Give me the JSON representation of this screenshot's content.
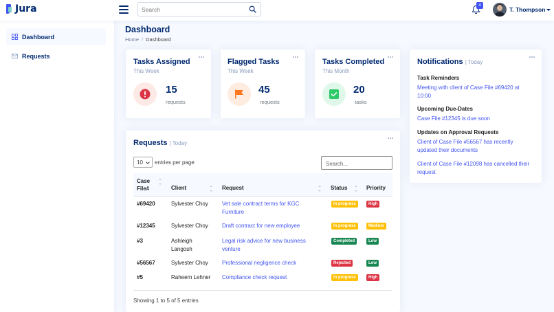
{
  "app": {
    "name": "Jura"
  },
  "header": {
    "search_placeholder": "Search",
    "notification_count": "4",
    "user_name": "T. Thompson"
  },
  "sidebar": {
    "items": [
      {
        "label": "Dashboard",
        "icon": "grid-icon",
        "active": true
      },
      {
        "label": "Requests",
        "icon": "envelope-icon",
        "active": false
      }
    ]
  },
  "page": {
    "title": "Dashboard",
    "breadcrumb": {
      "home": "Home",
      "separator": "/",
      "current": "Dashboard"
    }
  },
  "stats": [
    {
      "title": "Tasks Assigned",
      "period": "This Week",
      "value": "15",
      "unit": "requests",
      "icon": "exclamation-icon",
      "accent": "#dc3545",
      "tint": "#fde9e6"
    },
    {
      "title": "Flagged Tasks",
      "period": "This Week",
      "value": "45",
      "unit": "requests",
      "icon": "flag-icon",
      "accent": "#ff771d",
      "tint": "#ffece0"
    },
    {
      "title": "Tasks Completed",
      "period": "This Month",
      "value": "20",
      "unit": "tasks",
      "icon": "check-square-icon",
      "accent": "#2eca6a",
      "tint": "#e0f8e9"
    }
  ],
  "requests": {
    "title": "Requests",
    "period": "| Today",
    "entries_value": "10",
    "entries_label": "entries per page",
    "search_placeholder": "Search...",
    "columns": [
      "Case File#",
      "Client",
      "Request",
      "Status",
      "Priority"
    ],
    "case_col_line1": "Case",
    "case_col_line2": "File#",
    "rows": [
      {
        "case": "#69420",
        "client": "Sylvester Choy",
        "request": "Vet sale contract terms for KGC Furniture",
        "status": "In progress",
        "priority": "High"
      },
      {
        "case": "#12345",
        "client": "Sylvester Choy",
        "request": "Draft contract for new employee",
        "status": "In progress",
        "priority": "Medium"
      },
      {
        "case": "#3",
        "client": "Ashleigh Langosh",
        "request": "Legal risk advice for new business venture",
        "status": "Completed",
        "priority": "Low"
      },
      {
        "case": "#56567",
        "client": "Sylvester Choy",
        "request": "Professional negligence check",
        "status": "Rejected",
        "priority": "Low"
      },
      {
        "case": "#5",
        "client": "Raheem Lehner",
        "request": "Compliance check request",
        "status": "In progress",
        "priority": "High"
      }
    ],
    "footer": "Showing 1 to 5 of 5 entries"
  },
  "notifications": {
    "title": "Notifications",
    "period": "| Today",
    "sections": [
      {
        "heading": "Task Reminders",
        "links": [
          "Meeting with client of Case File #69420 at 10:00"
        ]
      },
      {
        "heading": "Upcoming Due-Dates",
        "links": [
          "Case File #12345 is due soon"
        ]
      },
      {
        "heading": "Updates on Approval Requests",
        "links": [
          "Client of Case File #56567 has recently updated their documents",
          "Client of Case File #12098 has cancelled their request"
        ]
      }
    ]
  }
}
